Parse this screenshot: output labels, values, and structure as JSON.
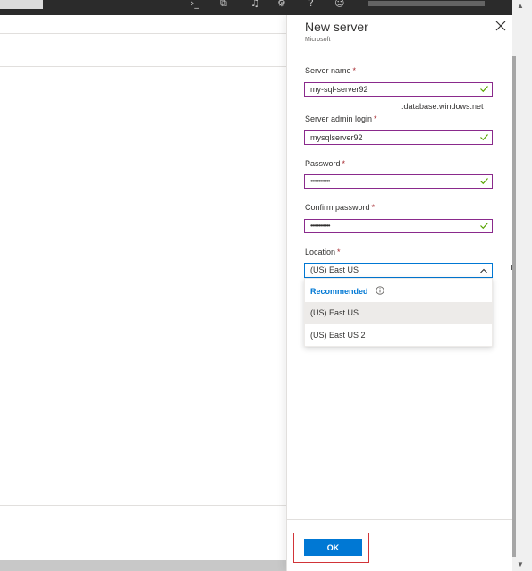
{
  "blade": {
    "title": "New server",
    "subtitle": "Microsoft"
  },
  "form": {
    "server_name": {
      "label": "Server name",
      "required": "*",
      "value": "my-sql-server92",
      "suffix": ".database.windows.net"
    },
    "admin_login": {
      "label": "Server admin login",
      "required": "*",
      "value": "mysqlserver92"
    },
    "password": {
      "label": "Password",
      "required": "*",
      "value": "••••••••••••"
    },
    "confirm_password": {
      "label": "Confirm password",
      "required": "*",
      "value": "••••••••••••"
    },
    "location": {
      "label": "Location",
      "required": "*",
      "value": "(US) East US",
      "group_label": "Recommended",
      "options": [
        "(US) East US",
        "(US) East US 2"
      ]
    }
  },
  "footer": {
    "ok_label": "OK"
  },
  "colors": {
    "accent": "#0078d4",
    "field_border": "#8a2a8c",
    "valid_check": "#57a300",
    "required": "#a4262c",
    "highlight": "#d13438"
  },
  "icons": [
    "terminal-icon",
    "feedback-icon",
    "notifications-icon",
    "settings-icon",
    "help-icon",
    "smiley-icon",
    "close-icon",
    "checkmark-icon",
    "chevron-up-icon",
    "info-icon"
  ]
}
